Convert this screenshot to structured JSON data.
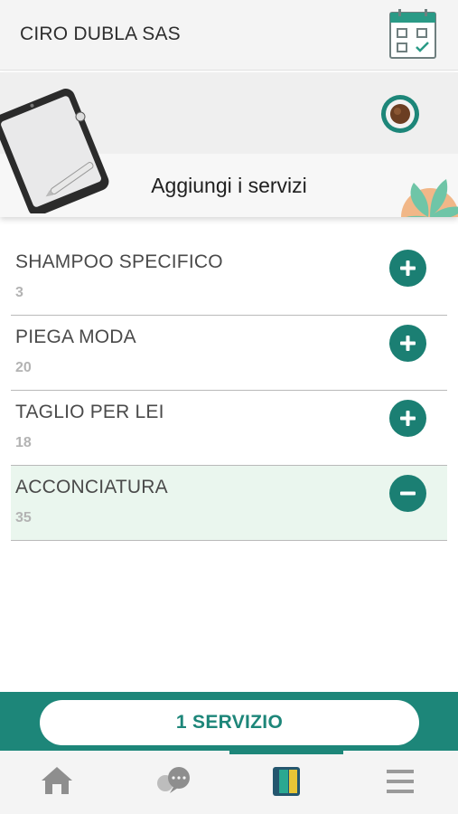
{
  "header": {
    "title": "CIRO DUBLA SAS",
    "calendar_icon": "calendar-check-icon"
  },
  "hero": {
    "subtitle": "Aggiungi i servizi"
  },
  "services": [
    {
      "name": "SHAMPOO SPECIFICO",
      "value": "3",
      "selected": false,
      "action": "plus-icon"
    },
    {
      "name": "PIEGA MODA",
      "value": "20",
      "selected": false,
      "action": "plus-icon"
    },
    {
      "name": "TAGLIO PER LEI",
      "value": "18",
      "selected": false,
      "action": "plus-icon"
    },
    {
      "name": "ACCONCIATURA",
      "value": "35",
      "selected": true,
      "action": "minus-icon"
    }
  ],
  "cta": {
    "label": "1 SERVIZIO"
  },
  "tabbar": {
    "items": [
      {
        "icon": "home-icon",
        "active": false
      },
      {
        "icon": "chat-icon",
        "active": false
      },
      {
        "icon": "booklet-icon",
        "active": true
      },
      {
        "icon": "menu-icon",
        "active": false
      }
    ]
  },
  "colors": {
    "accent": "#1d8679",
    "button": "#1b7f73",
    "selected_row": "#eaf6ee",
    "muted_text": "#b3b3b3"
  }
}
